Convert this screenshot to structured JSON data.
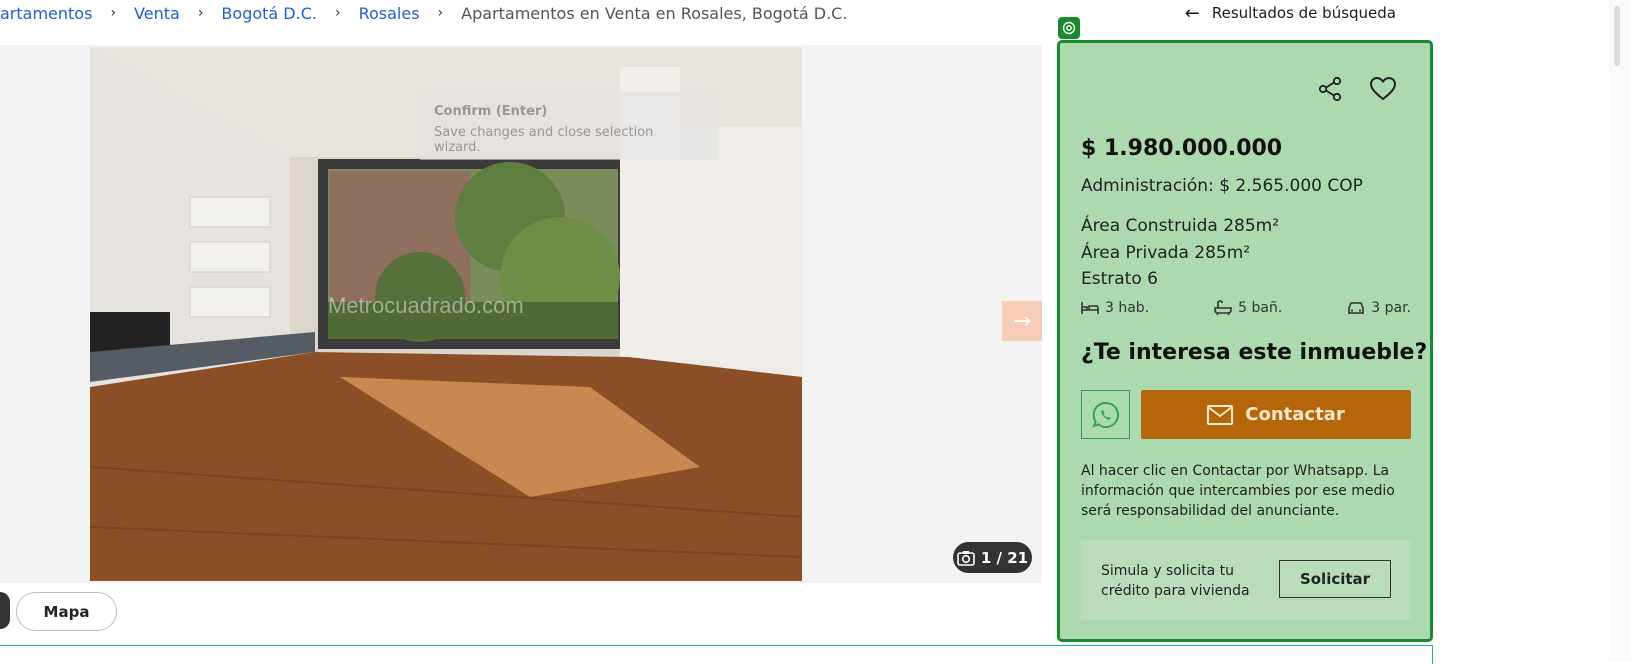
{
  "breadcrumb": {
    "items": [
      "artamentos",
      "Venta",
      "Bogotá D.C.",
      "Rosales"
    ],
    "separator": "›",
    "current": "Apartamentos en Venta en Rosales, Bogotá D.C."
  },
  "back_link": {
    "label": "Resultados de búsqueda",
    "icon": "arrow-left-icon"
  },
  "gallery": {
    "counter": "1 / 21",
    "next_icon": "arrow-right-icon",
    "watermark": "Metrocuadrado.com",
    "overlay": {
      "title": "Confirm (Enter)",
      "text": "Save changes and close selection wizard."
    }
  },
  "bottom": {
    "map_label": "Mapa"
  },
  "listing": {
    "price": "$ 1.980.000.000",
    "admin": "Administración: $ 2.565.000 COP",
    "area_built": "Área Construida 285m²",
    "area_private": "Área Privada 285m²",
    "estrato": "Estrato 6",
    "beds": "3 hab.",
    "baths": "5 bañ.",
    "parking": "3 par."
  },
  "contact": {
    "question": "¿Te interesa este inmueble?",
    "button_label": "Contactar",
    "disclaimer": "Al hacer clic en Contactar por Whatsapp. La información que intercambies por ese medio será responsabilidad del anunciante.",
    "credit_text": "Simula y solicita tu crédito para vivienda",
    "credit_button": "Solicitar"
  },
  "colors": {
    "card_bg": "#acd9ad",
    "card_border": "#1a8a2e",
    "contact_button": "#b5660b",
    "link": "#1f5fd6"
  }
}
